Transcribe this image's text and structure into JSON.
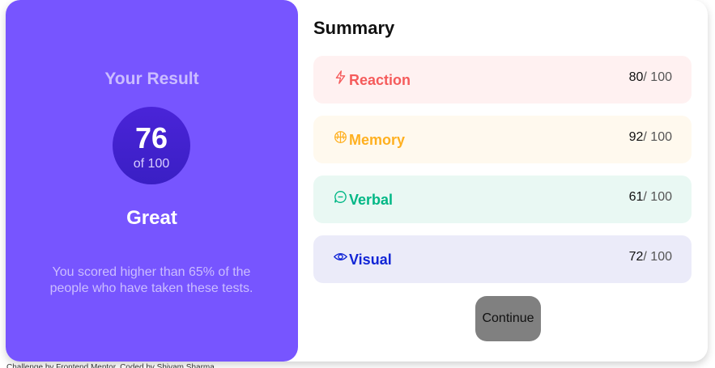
{
  "result": {
    "title": "Your Result",
    "score": "76",
    "score_of": "of 100",
    "rating": "Great",
    "message": "You scored higher than 65% of the people who have taken these tests."
  },
  "summary": {
    "title": "Summary",
    "items": [
      {
        "label": "Reaction",
        "score": "80",
        "of": "/ 100",
        "icon": "lightning-icon",
        "bg": "#fff1f1",
        "color": "#f55b5b"
      },
      {
        "label": "Memory",
        "score": "92",
        "of": "/ 100",
        "icon": "brain-icon",
        "bg": "#fff9ee",
        "color": "#ffb020"
      },
      {
        "label": "Verbal",
        "score": "61",
        "of": "/ 100",
        "icon": "chat-icon",
        "bg": "#e9f8f3",
        "color": "#00b785"
      },
      {
        "label": "Visual",
        "score": "72",
        "of": "/ 100",
        "icon": "eye-icon",
        "bg": "#ebebf9",
        "color": "#1125d6"
      }
    ]
  },
  "actions": {
    "continue_label": "Continue"
  },
  "footer": {
    "text": "Challenge by Frontend Mentor. Coded by Shivam Sharma."
  }
}
